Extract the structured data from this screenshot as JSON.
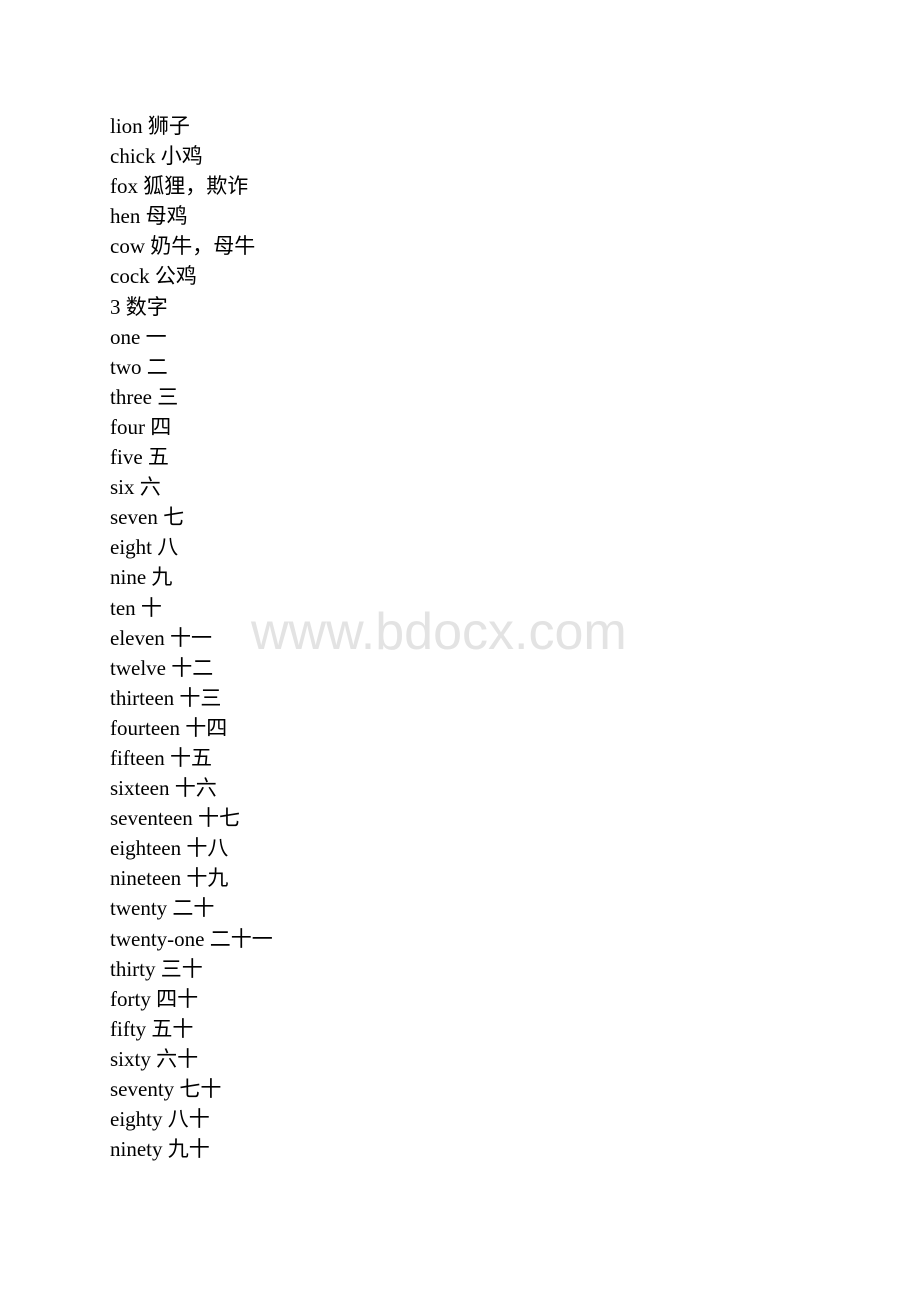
{
  "watermark": "www.bdocx.com",
  "lines": [
    "lion 狮子",
    "chick 小鸡",
    "fox 狐狸，欺诈",
    "hen 母鸡",
    "cow 奶牛，母牛",
    "cock 公鸡",
    "3 数字",
    "one 一",
    "two 二",
    "three 三",
    "four 四",
    "five 五",
    "six 六",
    "seven 七",
    "eight 八",
    "nine 九",
    "ten 十",
    "eleven 十一",
    "twelve 十二",
    "thirteen 十三",
    "fourteen 十四",
    "fifteen 十五",
    "sixteen 十六",
    "seventeen 十七",
    "eighteen 十八",
    "nineteen 十九",
    "twenty 二十",
    "twenty-one 二十一",
    "thirty 三十",
    "forty 四十",
    "fifty 五十",
    "sixty 六十",
    "seventy 七十",
    "eighty 八十",
    "ninety 九十"
  ]
}
